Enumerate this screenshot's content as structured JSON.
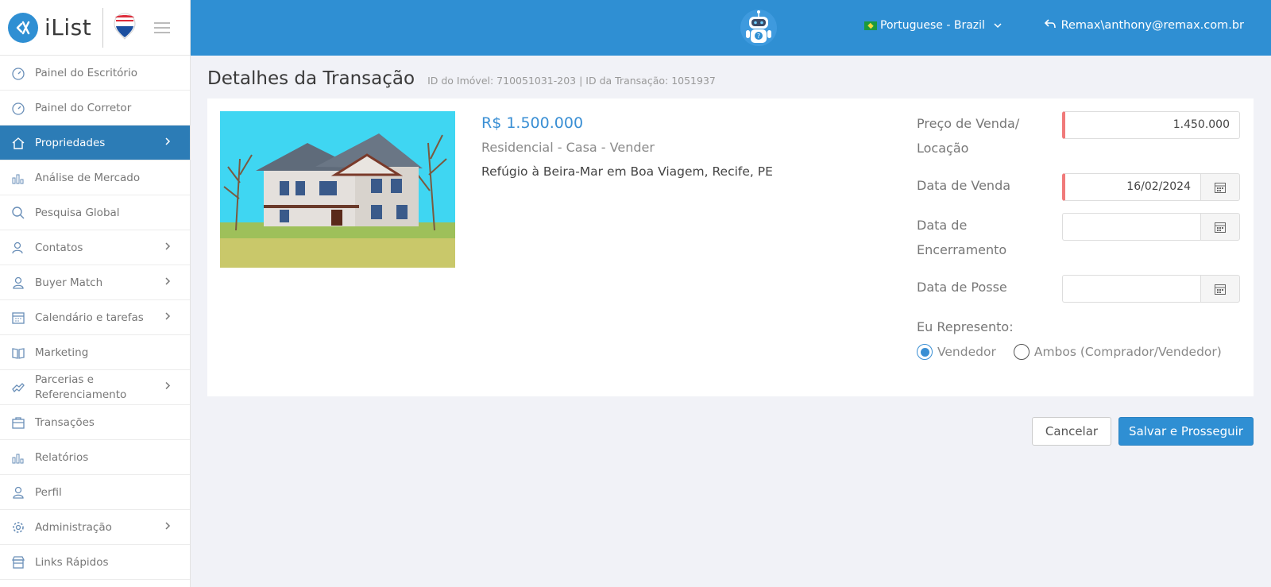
{
  "brand": {
    "name": "iList"
  },
  "sidebar": {
    "items": [
      {
        "label": "Painel do Escritório",
        "icon": "gauge-icon",
        "chevron": false
      },
      {
        "label": "Painel do Corretor",
        "icon": "gauge-icon",
        "chevron": false
      },
      {
        "label": "Propriedades",
        "icon": "home-icon",
        "chevron": true,
        "active": true
      },
      {
        "label": "Análise de Mercado",
        "icon": "bar-chart-icon",
        "chevron": false
      },
      {
        "label": "Pesquisa Global",
        "icon": "search-icon",
        "chevron": false
      },
      {
        "label": "Contatos",
        "icon": "contacts-icon",
        "chevron": true
      },
      {
        "label": "Buyer Match",
        "icon": "user-icon",
        "chevron": true
      },
      {
        "label": "Calendário e tarefas",
        "icon": "calendar-icon",
        "chevron": true
      },
      {
        "label": "Marketing",
        "icon": "book-icon",
        "chevron": false
      },
      {
        "label": "Parcerias e Referenciamento",
        "icon": "handshake-icon",
        "chevron": true
      },
      {
        "label": "Transações",
        "icon": "briefcase-icon",
        "chevron": false
      },
      {
        "label": "Relatórios",
        "icon": "bar-chart-icon",
        "chevron": false
      },
      {
        "label": "Perfil",
        "icon": "user-icon",
        "chevron": false
      },
      {
        "label": "Administração",
        "icon": "gear-icon",
        "chevron": true
      },
      {
        "label": "Links Rápidos",
        "icon": "store-icon",
        "chevron": false
      }
    ]
  },
  "topbar": {
    "language": "Portuguese - Brazil",
    "user": "Remax\\anthony@remax.com.br"
  },
  "page": {
    "title": "Detalhes da Transação",
    "ids": "ID do Imóvel: 710051031-203 | ID da Transação: 1051937"
  },
  "property": {
    "price": "R$ 1.500.000",
    "type": "Residencial - Casa - Vender",
    "address": "Refúgio à Beira-Mar em Boa Viagem, Recife, PE"
  },
  "form": {
    "sale_price_label": "Preço de Venda/ Locação",
    "sale_price_value": "1.450.000",
    "sale_date_label": "Data de Venda",
    "sale_date_value": "16/02/2024",
    "closing_date_label": "Data de Encerramento",
    "closing_date_value": "",
    "possession_date_label": "Data de Posse",
    "possession_date_value": "",
    "represent_label": "Eu Represento:",
    "option_seller": "Vendedor",
    "option_both": "Ambos (Comprador/Vendedor)"
  },
  "actions": {
    "cancel": "Cancelar",
    "save": "Salvar e Prosseguir"
  }
}
